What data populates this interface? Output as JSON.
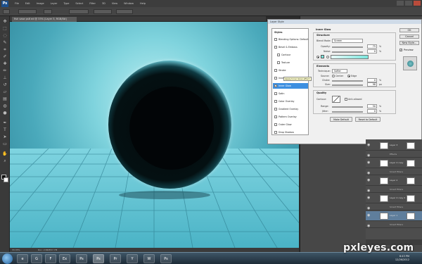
{
  "app": {
    "logo": "Ps",
    "menus": [
      "File",
      "Edit",
      "Image",
      "Layer",
      "Type",
      "Select",
      "Filter",
      "3D",
      "View",
      "Window",
      "Help"
    ]
  },
  "document": {
    "tab_title": "fish vase ps6 ed @ 33% (Layer 3, RGB/8#)",
    "zoom": "33.33%",
    "doc_info": "Doc: 2.84M/57.7M"
  },
  "dialog": {
    "title": "Layer Style",
    "styles_header": "Styles",
    "styles": [
      {
        "label": "Blending Options: Default",
        "checked": false,
        "selected": false,
        "indent": false
      },
      {
        "label": "Bevel & Emboss",
        "checked": false,
        "selected": false,
        "indent": false
      },
      {
        "label": "Contour",
        "checked": false,
        "selected": false,
        "indent": true
      },
      {
        "label": "Texture",
        "checked": false,
        "selected": false,
        "indent": true
      },
      {
        "label": "Stroke",
        "checked": false,
        "selected": false,
        "indent": false
      },
      {
        "label": "Inner Shadow",
        "checked": false,
        "selected": false,
        "indent": false
      },
      {
        "label": "Inner Glow",
        "checked": true,
        "selected": true,
        "indent": false
      },
      {
        "label": "Satin",
        "checked": false,
        "selected": false,
        "indent": false
      },
      {
        "label": "Color Overlay",
        "checked": false,
        "selected": false,
        "indent": false
      },
      {
        "label": "Gradient Overlay",
        "checked": false,
        "selected": false,
        "indent": false
      },
      {
        "label": "Pattern Overlay",
        "checked": false,
        "selected": false,
        "indent": false
      },
      {
        "label": "Outer Glow",
        "checked": false,
        "selected": false,
        "indent": false
      },
      {
        "label": "Drop Shadow",
        "checked": false,
        "selected": false,
        "indent": false
      }
    ],
    "tooltip": "Apply Inner Glow effect",
    "section_title": "Inner Glow",
    "structure": {
      "label": "Structure",
      "blend_mode_label": "Blend Mode:",
      "blend_mode": "Screen",
      "opacity_label": "Opacity:",
      "opacity": "75",
      "noise_label": "Noise:",
      "noise": "0",
      "unit": "%"
    },
    "elements": {
      "label": "Elements",
      "technique_label": "Technique:",
      "technique": "Softer",
      "source_label": "Source:",
      "center_label": "Center",
      "edge_label": "Edge",
      "choke_label": "Choke:",
      "choke": "0",
      "size_label": "Size:",
      "size": "98",
      "pct": "%",
      "px": "px"
    },
    "quality": {
      "label": "Quality",
      "contour_label": "Contour:",
      "antialiased_label": "Anti-aliased",
      "range_label": "Range:",
      "range": "50",
      "jitter_label": "Jitter:",
      "jitter": "0",
      "unit": "%"
    },
    "make_default": "Make Default",
    "reset_default": "Reset to Default",
    "ok": "OK",
    "cancel": "Cancel",
    "new_style": "New Style...",
    "preview_label": "Preview",
    "glow_color": "#7be7de"
  },
  "layers": [
    {
      "name": "Layer 3",
      "type": "layer"
    },
    {
      "name": "Effects",
      "type": "fx"
    },
    {
      "name": "Layer 4 copy",
      "type": "layer"
    },
    {
      "name": "Smart Filters",
      "type": "fx"
    },
    {
      "name": "Layer 2",
      "type": "layer"
    },
    {
      "name": "Smart Filters",
      "type": "fx"
    },
    {
      "name": "Layer 4 copy 2",
      "type": "layer"
    },
    {
      "name": "Smart Filters",
      "type": "fx"
    },
    {
      "name": "Layer 1",
      "type": "layer",
      "active": true
    },
    {
      "name": "Smart Filters",
      "type": "fx"
    }
  ],
  "taskbar": {
    "apps": [
      "e",
      "G",
      "F",
      "Ex",
      "Ps",
      "Ps",
      "Pr",
      "Y",
      "W",
      "Ps"
    ],
    "time": "6:43 PM",
    "date": "12/26/2012"
  },
  "watermark": "pxleyes.com"
}
